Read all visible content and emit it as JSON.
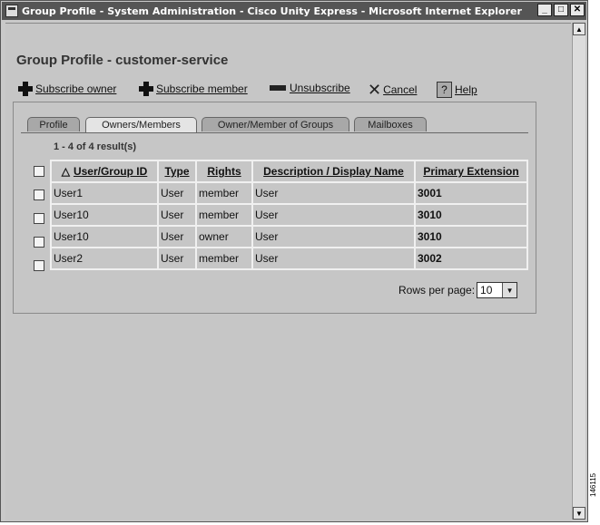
{
  "window": {
    "title": "Group Profile - System Administration - Cisco Unity Express - Microsoft Internet Explorer",
    "minimize": "_",
    "maximize": "□",
    "close": "✕"
  },
  "page": {
    "heading": "Group Profile - customer-service"
  },
  "toolbar": {
    "subscribe_owner": "Subscribe owner",
    "subscribe_member": "Subscribe member",
    "unsubscribe": "Unsubscribe",
    "cancel": "Cancel",
    "help": "Help"
  },
  "tabs": [
    {
      "label": "Profile"
    },
    {
      "label": "Owners/Members"
    },
    {
      "label": "Owner/Member of Groups"
    },
    {
      "label": "Mailboxes"
    }
  ],
  "results_text": "1 - 4 of 4 result(s)",
  "table": {
    "sort_indicator": "△",
    "headers": [
      "User/Group ID",
      "Type",
      "Rights",
      "Description / Display Name",
      "Primary Extension"
    ],
    "rows": [
      {
        "id": "User1",
        "type": "User",
        "rights": "member",
        "description": "User",
        "extension": "3001"
      },
      {
        "id": "User10",
        "type": "User",
        "rights": "member",
        "description": "User",
        "extension": "3010"
      },
      {
        "id": "User10",
        "type": "User",
        "rights": "owner",
        "description": "User",
        "extension": "3010"
      },
      {
        "id": "User2",
        "type": "User",
        "rights": "member",
        "description": "User",
        "extension": "3002"
      }
    ]
  },
  "pagination": {
    "rows_per_page_label": "Rows per page:",
    "rows_per_page_value": "10"
  },
  "figure_code": "146115"
}
